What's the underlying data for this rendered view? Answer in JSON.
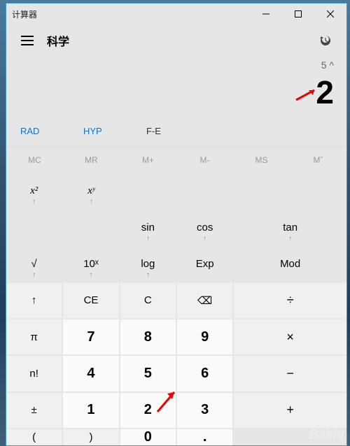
{
  "titlebar": {
    "title": "计算器"
  },
  "header": {
    "mode": "科学"
  },
  "display": {
    "expression": "5 ^",
    "result": "2"
  },
  "moderow": {
    "rad": "RAD",
    "hyp": "HYP",
    "fe": "F-E"
  },
  "memory": {
    "mc": "MC",
    "mr": "MR",
    "mplus": "M+",
    "mminus": "M-",
    "ms": "MS",
    "mrecall": "Mˇ"
  },
  "buttons": {
    "xsq": "x²",
    "xy": "xʸ",
    "sin": "sin",
    "cos": "cos",
    "tan": "tan",
    "sqrt": "√",
    "tenx": "10ˣ",
    "log": "log",
    "exp": "Exp",
    "mod": "Mod",
    "up": "↑",
    "ce": "CE",
    "c": "C",
    "back": "⌫",
    "div": "÷",
    "pi": "π",
    "n7": "7",
    "n8": "8",
    "n9": "9",
    "mul": "×",
    "fact": "n!",
    "n4": "4",
    "n5": "5",
    "n6": "6",
    "sub": "−",
    "pm": "±",
    "n1": "1",
    "n2": "2",
    "n3": "3",
    "add": "+",
    "lpar": "(",
    "rpar": ")",
    "n0": "0",
    "dot": "."
  },
  "watermark": "Baidu"
}
